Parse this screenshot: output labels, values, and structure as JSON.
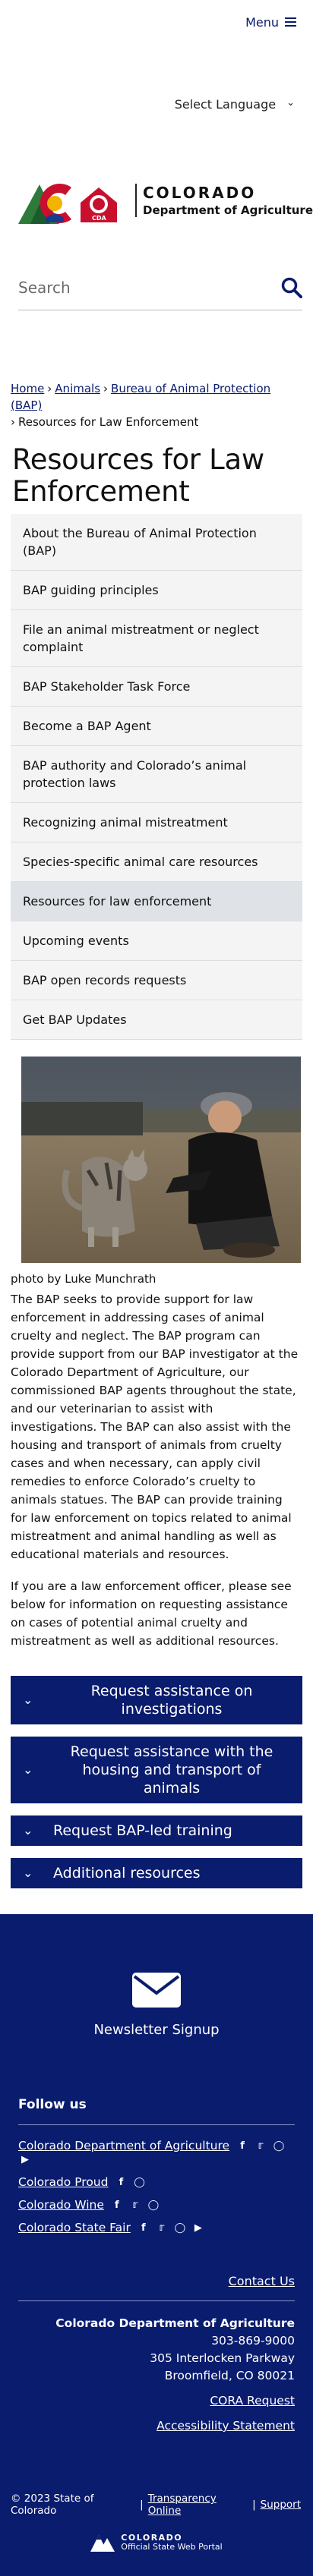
{
  "header": {
    "menu_label": "Menu",
    "language_label": "Select Language",
    "logo_title": "COLORADO",
    "logo_subtitle": "Department of Agriculture",
    "search_placeholder": "Search"
  },
  "breadcrumb": {
    "home": "Home",
    "animals": "Animals",
    "bap": "Bureau of Animal Protection (BAP)",
    "current": "Resources for Law Enforcement"
  },
  "page_title": "Resources for Law Enforcement",
  "subnav": [
    "About the Bureau of Animal Protection (BAP)",
    "BAP guiding principles",
    "File an animal mistreatment or neglect complaint",
    "BAP Stakeholder Task Force",
    "Become a BAP Agent",
    "BAP authority and Colorado’s animal protection laws",
    "Recognizing animal mistreatment",
    "Species-specific animal care resources",
    "Resources for law enforcement",
    "Upcoming events",
    "BAP open records requests",
    "Get BAP Updates"
  ],
  "photo_caption": "photo by Luke Munchrath",
  "body": {
    "p1": "The BAP seeks to provide support for law enforcement in addressing cases of animal cruelty and neglect. The BAP program can provide support from our BAP investigator at the Colorado Department of Agriculture, our commissioned BAP agents throughout the state, and our veterinarian to assist with investigations. The BAP can also assist with the housing and transport of animals from cruelty cases and when necessary, can apply civil remedies to enforce Colorado’s cruelty to animals statues. The BAP can provide training for law enforcement on topics related to animal mistreatment and animal handling as well as educational materials and resources.",
    "p2": "If you are a law enforcement officer, please see below for information on requesting assistance on cases of potential animal cruelty and mistreatment as well as additional resources."
  },
  "accordions": [
    "Request assistance on investigations",
    "Request assistance with the housing and transport of animals",
    "Request BAP-led training",
    "Additional resources"
  ],
  "footer": {
    "newsletter": "Newsletter Signup",
    "follow": "Follow us",
    "social": {
      "cda": "Colorado Department of Agriculture",
      "proud": "Colorado Proud",
      "wine": "Colorado Wine",
      "fair": "Colorado State Fair"
    },
    "contact": "Contact Us",
    "org": "Colorado Department of Agriculture",
    "phone": "303-869-9000",
    "street": "305 Interlocken Parkway",
    "city": "Broomfield, CO 80021",
    "cora": "CORA Request",
    "accessibility": "Accessibility Statement",
    "copyright": "© 2023 State of Colorado",
    "transparency": "Transparency Online",
    "support": "Support",
    "seal_title": "COLORADO",
    "seal_sub": "Official State Web Portal"
  },
  "colors": {
    "navy": "#0a1c6e",
    "nav_bg": "#f4f4f4",
    "active_bg": "#dfe2e6"
  }
}
